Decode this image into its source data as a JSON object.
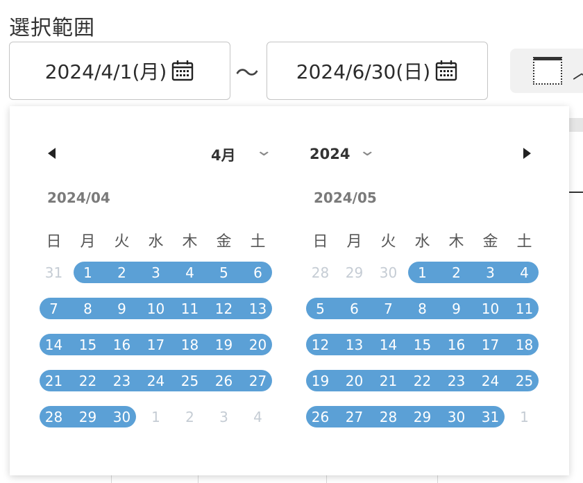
{
  "range_label": "選択範囲",
  "start_input": {
    "value": "2024/4/1(月)"
  },
  "separator": "～",
  "end_input": {
    "value": "2024/6/30(日)"
  },
  "picker": {
    "month_select": "4月",
    "year_select": "2024",
    "weekdays": [
      "日",
      "月",
      "火",
      "水",
      "木",
      "金",
      "土"
    ],
    "months": [
      {
        "title": "2024/04",
        "weeks": [
          [
            {
              "d": "31",
              "in": false
            },
            {
              "d": "1",
              "in": true
            },
            {
              "d": "2",
              "in": true
            },
            {
              "d": "3",
              "in": true
            },
            {
              "d": "4",
              "in": true
            },
            {
              "d": "5",
              "in": true
            },
            {
              "d": "6",
              "in": true
            }
          ],
          [
            {
              "d": "7",
              "in": true
            },
            {
              "d": "8",
              "in": true
            },
            {
              "d": "9",
              "in": true
            },
            {
              "d": "10",
              "in": true
            },
            {
              "d": "11",
              "in": true
            },
            {
              "d": "12",
              "in": true
            },
            {
              "d": "13",
              "in": true
            }
          ],
          [
            {
              "d": "14",
              "in": true
            },
            {
              "d": "15",
              "in": true
            },
            {
              "d": "16",
              "in": true
            },
            {
              "d": "17",
              "in": true
            },
            {
              "d": "18",
              "in": true
            },
            {
              "d": "19",
              "in": true
            },
            {
              "d": "20",
              "in": true
            }
          ],
          [
            {
              "d": "21",
              "in": true
            },
            {
              "d": "22",
              "in": true
            },
            {
              "d": "23",
              "in": true,
              "today": true
            },
            {
              "d": "24",
              "in": true
            },
            {
              "d": "25",
              "in": true
            },
            {
              "d": "26",
              "in": true
            },
            {
              "d": "27",
              "in": true
            }
          ],
          [
            {
              "d": "28",
              "in": true
            },
            {
              "d": "29",
              "in": true
            },
            {
              "d": "30",
              "in": true
            },
            {
              "d": "1",
              "in": false
            },
            {
              "d": "2",
              "in": false
            },
            {
              "d": "3",
              "in": false
            },
            {
              "d": "4",
              "in": false
            }
          ]
        ]
      },
      {
        "title": "2024/05",
        "weeks": [
          [
            {
              "d": "28",
              "in": false
            },
            {
              "d": "29",
              "in": false
            },
            {
              "d": "30",
              "in": false
            },
            {
              "d": "1",
              "in": true
            },
            {
              "d": "2",
              "in": true
            },
            {
              "d": "3",
              "in": true
            },
            {
              "d": "4",
              "in": true
            }
          ],
          [
            {
              "d": "5",
              "in": true
            },
            {
              "d": "6",
              "in": true
            },
            {
              "d": "7",
              "in": true
            },
            {
              "d": "8",
              "in": true
            },
            {
              "d": "9",
              "in": true
            },
            {
              "d": "10",
              "in": true
            },
            {
              "d": "11",
              "in": true
            }
          ],
          [
            {
              "d": "12",
              "in": true
            },
            {
              "d": "13",
              "in": true
            },
            {
              "d": "14",
              "in": true
            },
            {
              "d": "15",
              "in": true
            },
            {
              "d": "16",
              "in": true
            },
            {
              "d": "17",
              "in": true
            },
            {
              "d": "18",
              "in": true
            }
          ],
          [
            {
              "d": "19",
              "in": true
            },
            {
              "d": "20",
              "in": true
            },
            {
              "d": "21",
              "in": true
            },
            {
              "d": "22",
              "in": true
            },
            {
              "d": "23",
              "in": true
            },
            {
              "d": "24",
              "in": true
            },
            {
              "d": "25",
              "in": true
            }
          ],
          [
            {
              "d": "26",
              "in": true
            },
            {
              "d": "27",
              "in": true
            },
            {
              "d": "28",
              "in": true
            },
            {
              "d": "29",
              "in": true
            },
            {
              "d": "30",
              "in": true
            },
            {
              "d": "31",
              "in": true
            },
            {
              "d": "1",
              "in": false
            }
          ]
        ]
      }
    ]
  },
  "colors": {
    "range": "#5ba0d6",
    "outside_day": "#c5ccd4"
  },
  "icons": [
    "calendar-icon",
    "prev-month-icon",
    "next-month-icon",
    "chevron-down-icon",
    "layout-icon",
    "chevron-up-icon"
  ]
}
